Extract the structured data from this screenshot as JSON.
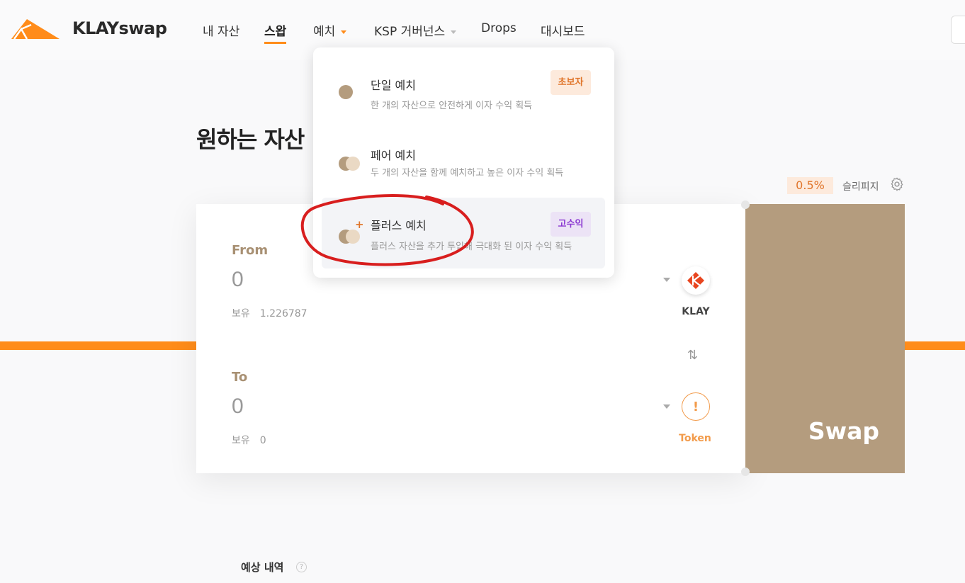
{
  "app": {
    "brand": "KLAYswap",
    "brand_color": "#ff8c1a"
  },
  "nav": {
    "items": [
      {
        "label": "내 자산"
      },
      {
        "label": "스왑"
      },
      {
        "label": "예치"
      },
      {
        "label": "KSP 거버넌스"
      },
      {
        "label": "Drops"
      },
      {
        "label": "대시보드"
      }
    ]
  },
  "page": {
    "title": "원하는 자산"
  },
  "slippage": {
    "value": "0.5%",
    "label": "슬리피지"
  },
  "swap": {
    "from": {
      "label": "From",
      "amount": "0",
      "balance_label": "보유",
      "balance": "1.226787",
      "token": "KLAY"
    },
    "to": {
      "label": "To",
      "amount": "0",
      "balance_label": "보유",
      "balance": "0",
      "token": "Token"
    },
    "button_label": "Swap",
    "direction_icon": "⇅"
  },
  "estimate": {
    "label": "예상 내역",
    "help": "?"
  },
  "dropdown": {
    "items": [
      {
        "title": "단일 예치",
        "desc": "한 개의 자산으로 안전하게 이자 수익 획득",
        "badge": "초보자"
      },
      {
        "title": "페어 예치",
        "desc": "두 개의 자산을 함께 예치하고 높은 이자 수익 획득",
        "badge": ""
      },
      {
        "title": "플러스 예치",
        "desc": "플러스 자산을 추가 투입해 극대화 된 이자 수익 획득",
        "badge": "고수익"
      }
    ]
  },
  "colors": {
    "accent": "#ff8c1a",
    "swap_button": "#b49c7e",
    "annotation": "#d81e1e"
  }
}
